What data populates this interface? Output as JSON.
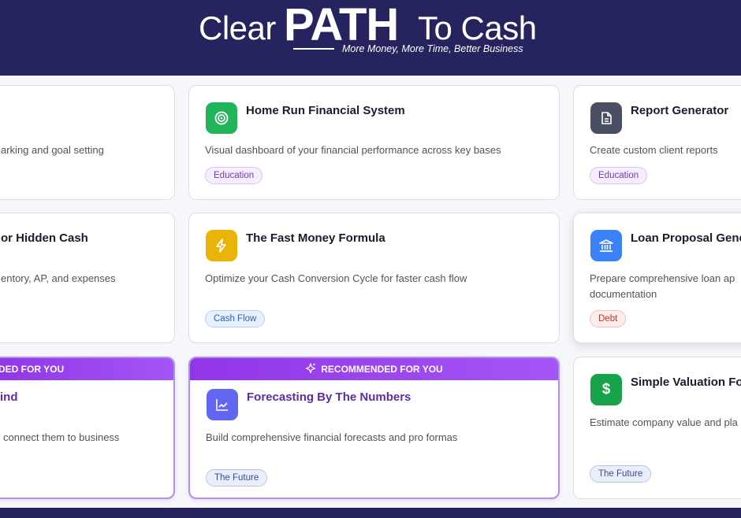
{
  "header": {
    "logo_part1": "Clear",
    "logo_part2": "PATH",
    "logo_part3": "To Cash",
    "tagline": "More Money, More Time, Better Business"
  },
  "colors": {
    "header_bg": "#25245e",
    "recommended_band": "#9b44ee",
    "icon_green": "#22b45a",
    "icon_slate": "#4a5061",
    "icon_amber": "#eab308",
    "icon_blue": "#3b82f6",
    "icon_indigo": "#6366f1",
    "icon_emerald": "#16a34a"
  },
  "cards": {
    "c0": {
      "desc": "arking and goal setting"
    },
    "c1": {
      "icon": "target-icon",
      "title": "Home Run Financial System",
      "desc": "Visual dashboard of your financial performance across key bases",
      "tag": "Education"
    },
    "c2": {
      "icon": "document-icon",
      "title": "Report Generator",
      "desc": "Create custom client reports",
      "tag": "Education"
    },
    "c3": {
      "title": "or Hidden Cash",
      "desc": "entory, AP, and expenses"
    },
    "c4": {
      "icon": "lightning-icon",
      "title": "The Fast Money Formula",
      "desc": "Optimize your Cash Conversion Cycle for faster cash flow",
      "tag": "Cash Flow"
    },
    "c5": {
      "icon": "bank-icon",
      "title": "Loan Proposal Gene",
      "desc1": "Prepare comprehensive loan ap",
      "desc2": "documentation",
      "tag": "Debt"
    },
    "c6": {
      "band": "DED FOR YOU",
      "title": "ind",
      "desc": "connect them to business"
    },
    "c7": {
      "band": "RECOMMENDED FOR YOU",
      "icon": "line-chart-icon",
      "title": "Forecasting By The Numbers",
      "desc": "Build comprehensive financial forecasts and pro formas",
      "tag": "The Future"
    },
    "c8": {
      "icon": "dollar-icon",
      "title": "Simple Valuation Fo",
      "desc": "Estimate company value and pla",
      "tag": "The Future"
    }
  }
}
